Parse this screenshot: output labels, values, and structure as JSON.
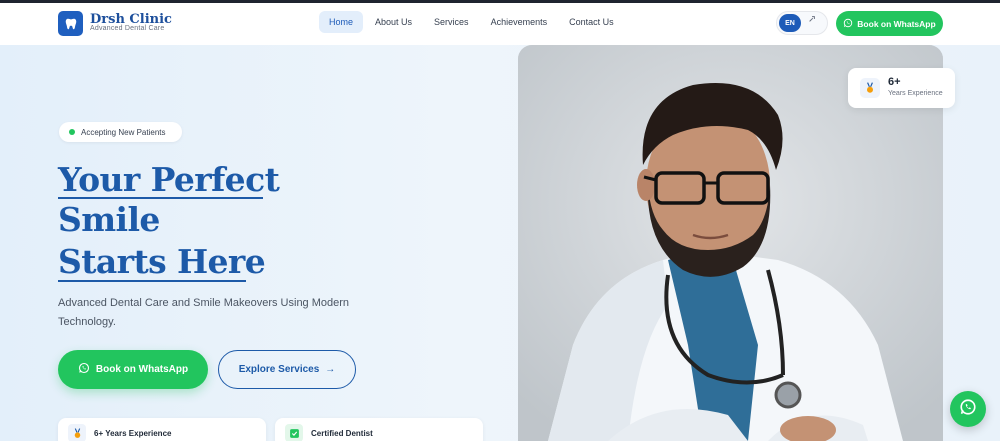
{
  "brand": {
    "name": "Drsh Clinic",
    "tagline": "Advanced Dental Care",
    "logo_icon": "tooth-icon"
  },
  "nav": {
    "items": [
      {
        "label": "Home",
        "active": true
      },
      {
        "label": "About Us",
        "active": false
      },
      {
        "label": "Services",
        "active": false
      },
      {
        "label": "Achievements",
        "active": false
      },
      {
        "label": "Contact Us",
        "active": false
      }
    ]
  },
  "language": {
    "current": "EN",
    "alternate_icon": "language-icon"
  },
  "header_cta": {
    "label": "Book on WhatsApp",
    "icon": "whatsapp-icon"
  },
  "hero": {
    "badge": "Accepting New Patients",
    "title_line1": "Your Perfect",
    "title_line2": "Smile",
    "title_line3": "Starts Here",
    "subtitle": "Advanced Dental Care and Smile Makeovers Using Modern Technology.",
    "primary_button": "Book on WhatsApp",
    "secondary_button": "Explore Services",
    "secondary_button_arrow": "→"
  },
  "feature_cards": [
    {
      "label": "6+ Years Experience",
      "icon": "medal-icon"
    },
    {
      "label": "Certified Dentist",
      "icon": "check-icon"
    }
  ],
  "experience_badge": {
    "value": "6+",
    "label": "Years Experience",
    "icon": "medal-icon"
  },
  "colors": {
    "primary": "#1d5aa8",
    "whatsapp": "#22c55e",
    "hero_bg": "#eaf3fb"
  }
}
